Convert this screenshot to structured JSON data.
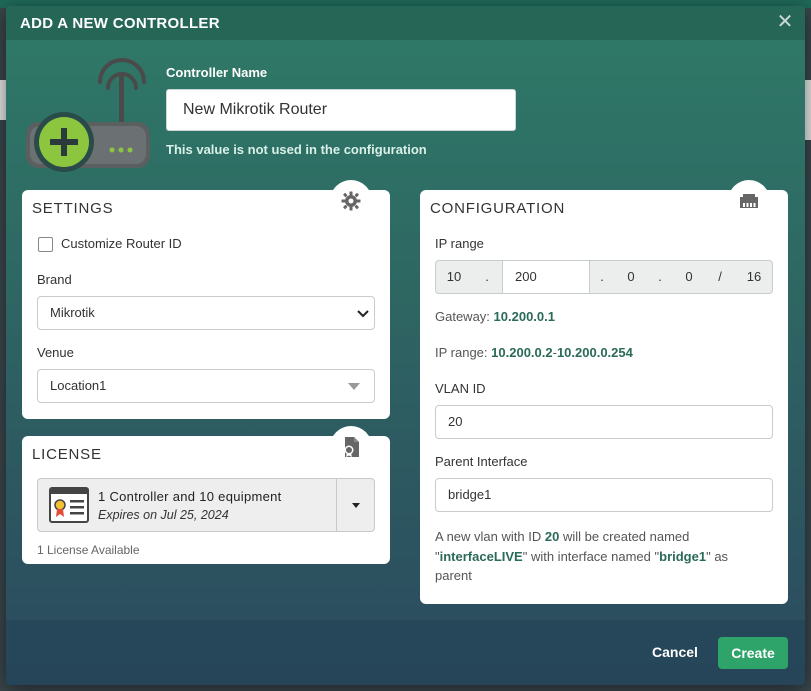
{
  "modal": {
    "title": "ADD A NEW CONTROLLER",
    "close_glyph": "✕"
  },
  "controller_name": {
    "label": "Controller Name",
    "value": "New Mikrotik Router",
    "hint": "This value is not used in the configuration"
  },
  "settings": {
    "title": "SETTINGS",
    "icon": "gear-icon",
    "customize_router_id_label": "Customize Router ID",
    "customize_router_id_checked": false,
    "brand_label": "Brand",
    "brand_value": "Mikrotik",
    "venue_label": "Venue",
    "venue_value": "Location1"
  },
  "license": {
    "title": "LICENSE",
    "icon": "license-icon",
    "name": "1 Controller and 10 equipment",
    "expires": "Expires on Jul 25, 2024",
    "available": "1 License Available"
  },
  "configuration": {
    "title": "CONFIGURATION",
    "icon": "network-port-icon",
    "ip_range_label": "IP range",
    "octet1": "10",
    "sep1": ".",
    "octet2": "200",
    "sep2": ".",
    "octet3": "0",
    "sep3": ".",
    "octet4": "0",
    "slash": "/",
    "prefix": "16",
    "gateway_label": "Gateway:",
    "gateway_value": "10.200.0.1",
    "ip_range_info_label": "IP range:",
    "ip_range_start": "10.200.0.2",
    "ip_range_dash": "-",
    "ip_range_end": "10.200.0.254",
    "vlan_label": "VLAN ID",
    "vlan_value": "20",
    "parent_label": "Parent Interface",
    "parent_value": "bridge1",
    "note_1": "A new vlan with ID",
    "note_vlan": "20",
    "note_2": "will be created named",
    "note_q1": "\"",
    "note_iface": "interfaceLIVE",
    "note_3": "\" with interface named \"",
    "note_parent": "bridge1",
    "note_4": "\" as parent"
  },
  "footer": {
    "cancel_label": "Cancel",
    "create_label": "Create"
  },
  "colors": {
    "accent_green": "#2ea46a",
    "router_green": "#8cc63f",
    "header_teal": "#2f7a68"
  }
}
